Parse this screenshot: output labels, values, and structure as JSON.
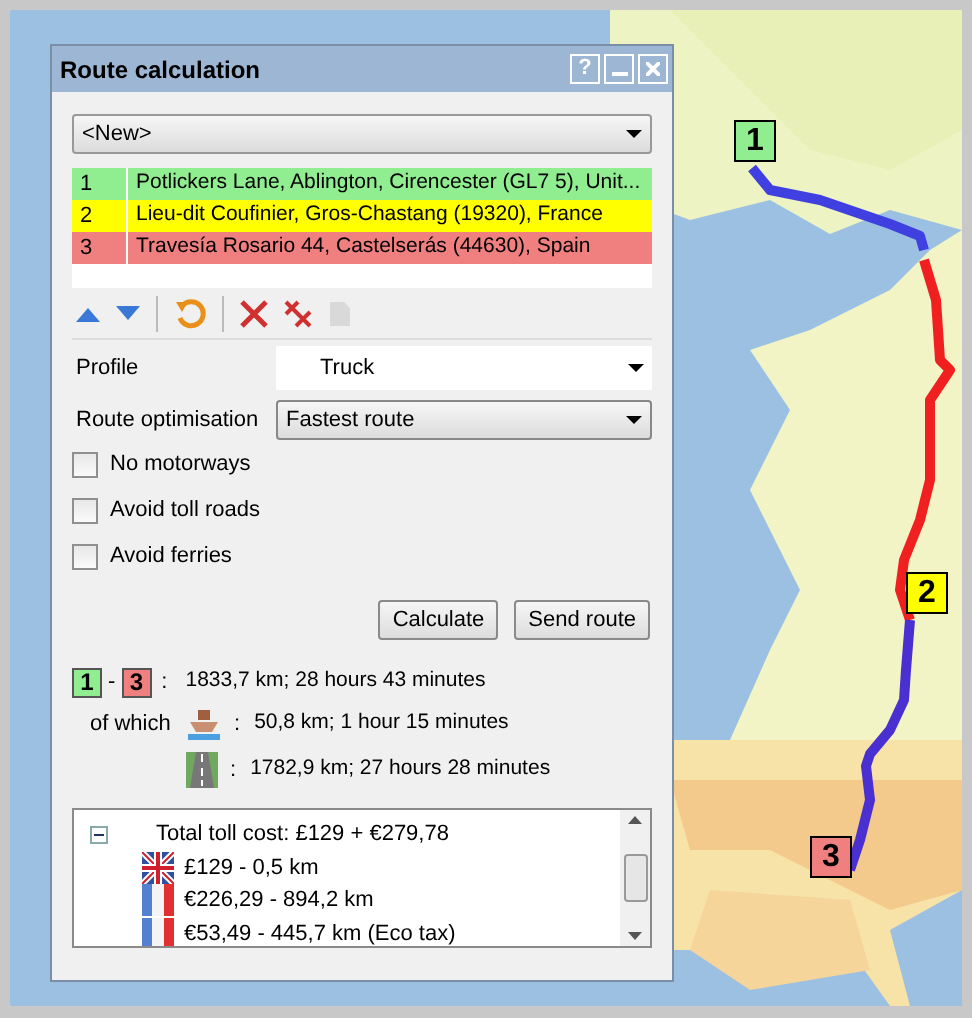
{
  "dialog": {
    "title": "Route calculation",
    "help_button": "?"
  },
  "route_select": {
    "value": "<New>"
  },
  "waypoints": [
    {
      "index": "1",
      "address": "Potlickers Lane, Ablington, Cirencester (GL7 5), Unit...",
      "color": "#90ee90"
    },
    {
      "index": "2",
      "address": "Lieu-dit Coufinier, Gros-Chastang (19320), France",
      "color": "#ffff00"
    },
    {
      "index": "3",
      "address": "Travesía Rosario 44, Castelserás (44630), Spain",
      "color": "#f08080"
    }
  ],
  "toolbar": [
    {
      "kind": "up",
      "disabled": false
    },
    {
      "kind": "down",
      "disabled": false
    },
    {
      "kind": "reverse",
      "disabled": false
    },
    {
      "kind": "delete",
      "disabled": false
    },
    {
      "kind": "delete_all",
      "disabled": false
    },
    {
      "kind": "copy",
      "disabled": true
    }
  ],
  "profile": {
    "label": "Profile",
    "value": "Truck"
  },
  "optimisation": {
    "label": "Route optimisation",
    "value": "Fastest route"
  },
  "options": [
    {
      "label": "No motorways",
      "checked": false
    },
    {
      "label": "Avoid toll roads",
      "checked": false
    },
    {
      "label": "Avoid ferries",
      "checked": false
    }
  ],
  "buttons": [
    "Calculate",
    "Send route"
  ],
  "summary": {
    "from": {
      "label": "1",
      "color": "#90ee90"
    },
    "dash": "-",
    "to": {
      "label": "3",
      "color": "#f08080"
    },
    "colon": ":",
    "total": "1833,7 km; 28 hours 43 minutes",
    "of_which": "of which",
    "parts": [
      {
        "kind": "ferry",
        "colon": ":",
        "text": "50,8 km; 1 hour 15 minutes"
      },
      {
        "kind": "road",
        "colon": ":",
        "text": "1782,9 km; 27 hours 28 minutes"
      }
    ]
  },
  "toll_tree": {
    "text": "Total toll cost: £129 + €279,78",
    "expanded": true,
    "children": [
      {
        "kind": "uk",
        "text": "£129 - 0,5 km"
      },
      {
        "kind": "france",
        "text": "€226,29 - 894,2 km"
      },
      {
        "kind": "france",
        "text": "€53,49 - 445,7 km (Eco tax)"
      }
    ]
  },
  "map_markers": [
    {
      "label": "1",
      "color": "#90ee90"
    },
    {
      "label": "2",
      "color": "#ffff00"
    },
    {
      "label": "3",
      "color": "#f08080"
    }
  ]
}
